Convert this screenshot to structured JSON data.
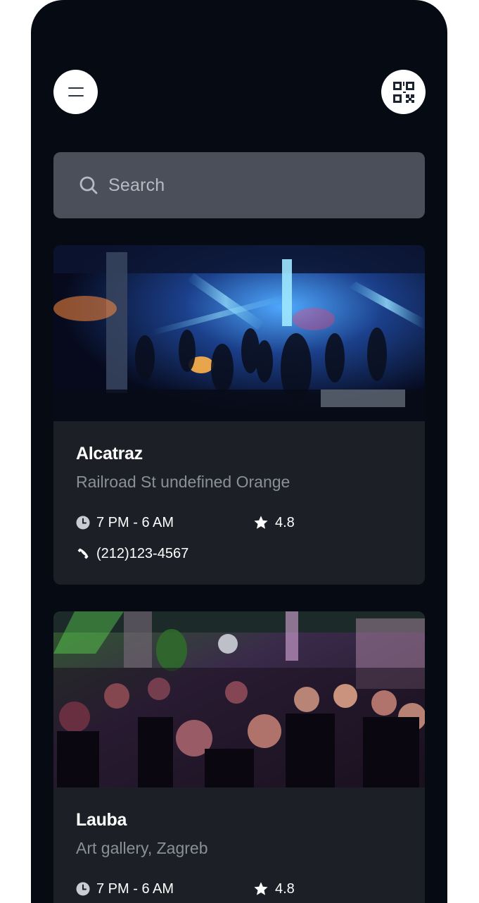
{
  "header": {
    "menu_icon": "hamburger-icon",
    "qr_icon": "qr-code-icon"
  },
  "search": {
    "placeholder": "Search",
    "icon": "search-icon"
  },
  "colors": {
    "background": "#050a13",
    "card": "#1c1f26",
    "search_bg": "#4a4f5a",
    "muted_text": "#8b8f97"
  },
  "venues": [
    {
      "name": "Alcatraz",
      "address": "Railroad St undefined Orange",
      "hours": "7 PM - 6 AM",
      "rating": "4.8",
      "phone": "(212)123-4567",
      "image": "nightclub-photo-blue-lights"
    },
    {
      "name": "Lauba",
      "address": "Art gallery, Zagreb",
      "hours": "7 PM - 6 AM",
      "rating": "4.8",
      "image": "nightclub-photo-crowd-dancing"
    }
  ]
}
